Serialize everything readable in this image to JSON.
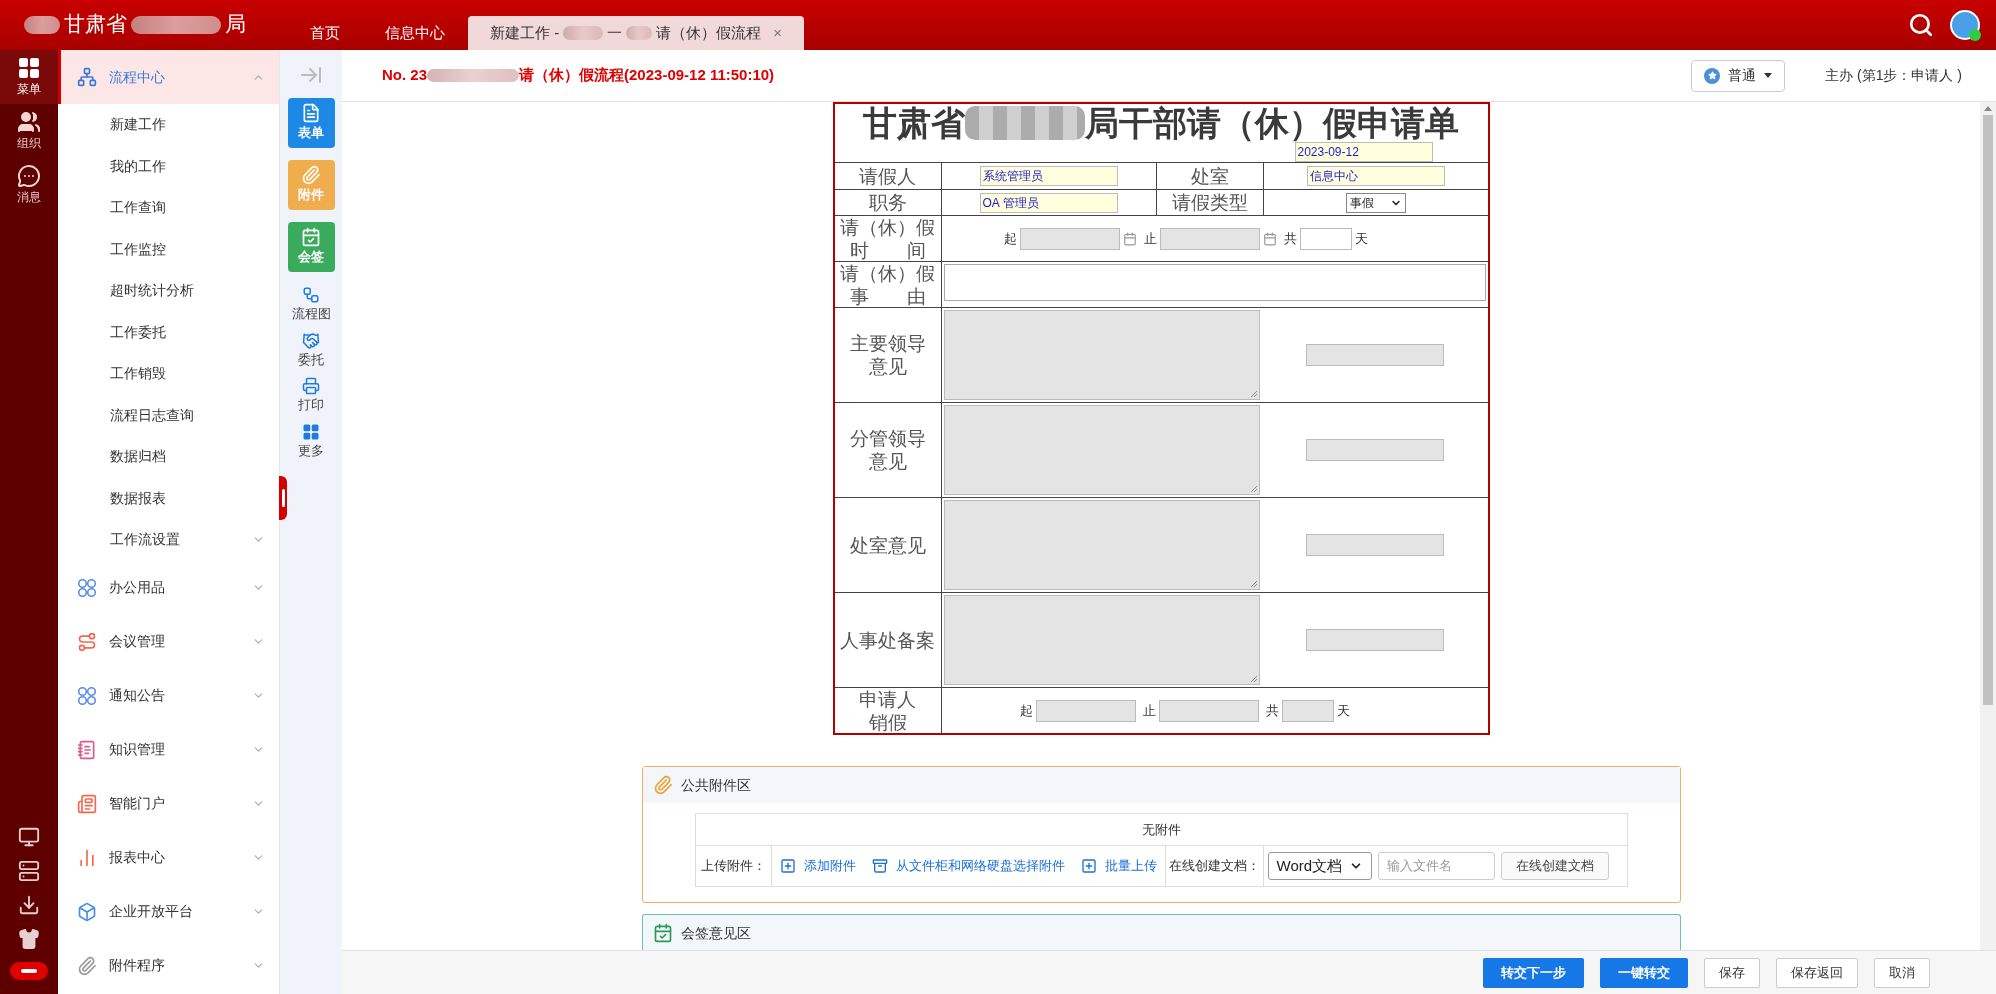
{
  "header": {
    "org_name_parts": [
      "甘肃省",
      "局"
    ],
    "nav_tabs": [
      {
        "label_parts": [
          "首页"
        ],
        "selected": false
      },
      {
        "label_parts": [
          "信息中心"
        ],
        "selected": false
      },
      {
        "label_parts": [
          "新建工作 -",
          "一",
          "请（休）假流程"
        ],
        "selected": true,
        "close": "×"
      }
    ]
  },
  "rail": {
    "items": [
      {
        "label": "菜单",
        "selected": true
      },
      {
        "label": "组织",
        "selected": false
      },
      {
        "label": "消息",
        "selected": false
      }
    ]
  },
  "sidebar": {
    "groups": [
      {
        "label": "流程中心",
        "selected": true,
        "expanded": true,
        "children": [
          {
            "label": "新建工作",
            "kind": "link"
          },
          {
            "label": "我的工作",
            "kind": "link"
          },
          {
            "label": "工作查询",
            "kind": "link"
          },
          {
            "label": "工作监控",
            "kind": "link"
          },
          {
            "label": "超时统计分析",
            "kind": "link"
          },
          {
            "label": "工作委托",
            "kind": "link"
          },
          {
            "label": "工作销毁",
            "kind": "link"
          },
          {
            "label": "流程日志查询",
            "kind": "link"
          },
          {
            "label": "数据归档",
            "kind": "link"
          },
          {
            "label": "数据报表",
            "kind": "link"
          },
          {
            "label": "工作流设置",
            "kind": "folder",
            "expanded": false
          }
        ]
      },
      {
        "label": "办公用品",
        "selected": false,
        "expanded": false
      },
      {
        "label": "会议管理",
        "selected": false,
        "expanded": false
      },
      {
        "label": "通知公告",
        "selected": false,
        "expanded": false
      },
      {
        "label": "知识管理",
        "selected": false,
        "expanded": false
      },
      {
        "label": "智能门户",
        "selected": false,
        "expanded": false
      },
      {
        "label": "报表中心",
        "selected": false,
        "expanded": false
      },
      {
        "label": "企业开放平台",
        "selected": false,
        "expanded": false
      },
      {
        "label": "附件程序",
        "selected": false,
        "expanded": false
      }
    ]
  },
  "tools": [
    {
      "label": "表单",
      "kind": "tile",
      "color": "#1e88e5"
    },
    {
      "label": "附件",
      "kind": "tile",
      "color": "#f0ad4e"
    },
    {
      "label": "会签",
      "kind": "tile",
      "color": "#3aaa5c"
    },
    {
      "label": "流程图",
      "kind": "plain"
    },
    {
      "label": "委托",
      "kind": "plain"
    },
    {
      "label": "打印",
      "kind": "plain"
    },
    {
      "label": "更多",
      "kind": "plain"
    }
  ],
  "doc": {
    "title_parts": [
      "No. 23",
      "请（休）假流程(2023-09-12 11:50:10)"
    ],
    "priority": "普通",
    "step": "主办 (第1步：申请人 )"
  },
  "form": {
    "title_parts": [
      "甘肃省",
      "局干部请（休）假申请单"
    ],
    "date": "2023-09-12",
    "applicant_label": "请假人",
    "applicant": "系统管理员",
    "dept_label": "处室",
    "dept": "信息中心",
    "position_label": "职务",
    "position": "OA 管理员",
    "type_label": "请假类型",
    "type": "事假",
    "time_label_lines": [
      "请（休）假",
      "时　　间"
    ],
    "start_label": "起",
    "end_label": "止",
    "total_label": "共",
    "days_unit": "天",
    "reason_label_lines": [
      "请（休）假",
      "事　　由"
    ],
    "opinions": [
      {
        "label_lines": [
          "主要领导",
          "意见"
        ]
      },
      {
        "label_lines": [
          "分管领导",
          "意见"
        ]
      },
      {
        "label_lines": [
          "处室意见"
        ]
      },
      {
        "label_lines": [
          "人事处备案"
        ]
      }
    ],
    "cancel": {
      "label_lines": [
        "申请人",
        "销假"
      ],
      "start_label": "起",
      "end_label": "止",
      "total_label": "共",
      "days_unit": "天"
    }
  },
  "attachments": {
    "title": "公共附件区",
    "empty_text": "无附件",
    "upload_label": "上传附件：",
    "actions": [
      {
        "label": "添加附件"
      },
      {
        "label": "从文件柜和网络硬盘选择附件"
      },
      {
        "label": "批量上传"
      }
    ],
    "create_label": "在线创建文档：",
    "doc_type": "Word文档",
    "filename_placeholder": "输入文件名",
    "create_button": "在线创建文档"
  },
  "countersign": {
    "title": "会签意见区"
  },
  "footer": {
    "buttons": [
      {
        "label": "转交下一步",
        "kind": "primary"
      },
      {
        "label": "一键转交",
        "kind": "primary"
      },
      {
        "label": "保存",
        "kind": "default"
      },
      {
        "label": "保存返回",
        "kind": "default"
      },
      {
        "label": "取消",
        "kind": "default"
      }
    ]
  }
}
